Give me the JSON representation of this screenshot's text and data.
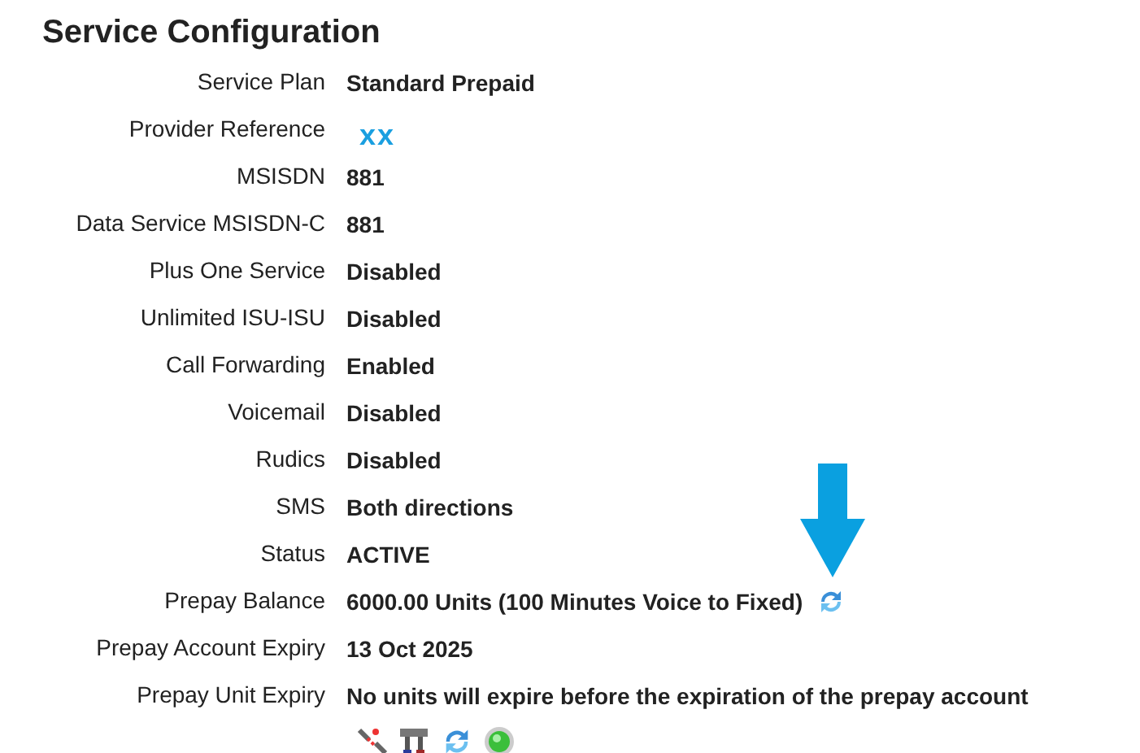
{
  "title": "Service Configuration",
  "rows": [
    {
      "label": "Service Plan",
      "value": "Standard Prepaid",
      "kind": "text",
      "refresh": false
    },
    {
      "label": "Provider Reference",
      "value": "xx",
      "kind": "redacted",
      "refresh": false
    },
    {
      "label": "MSISDN",
      "value": "881",
      "kind": "text",
      "refresh": false
    },
    {
      "label": "Data Service MSISDN-C",
      "value": "881",
      "kind": "text",
      "refresh": false
    },
    {
      "label": "Plus One Service",
      "value": "Disabled",
      "kind": "text",
      "refresh": false
    },
    {
      "label": "Unlimited ISU-ISU",
      "value": "Disabled",
      "kind": "text",
      "refresh": false
    },
    {
      "label": "Call Forwarding",
      "value": "Enabled",
      "kind": "text",
      "refresh": false
    },
    {
      "label": "Voicemail",
      "value": "Disabled",
      "kind": "text",
      "refresh": false
    },
    {
      "label": "Rudics",
      "value": "Disabled",
      "kind": "text",
      "refresh": false
    },
    {
      "label": "SMS",
      "value": "Both directions",
      "kind": "text",
      "refresh": false
    },
    {
      "label": "Status",
      "value": "ACTIVE",
      "kind": "text",
      "refresh": false
    },
    {
      "label": "Prepay Balance",
      "value": "6000.00 Units (100 Minutes Voice to Fixed)",
      "kind": "text",
      "refresh": true
    },
    {
      "label": "Prepay Account Expiry",
      "value": "13 Oct 2025",
      "kind": "text",
      "refresh": false
    },
    {
      "label": "Prepay Unit Expiry",
      "value": "No units will expire before the expiration of the prepay account",
      "kind": "text",
      "refresh": false
    }
  ]
}
